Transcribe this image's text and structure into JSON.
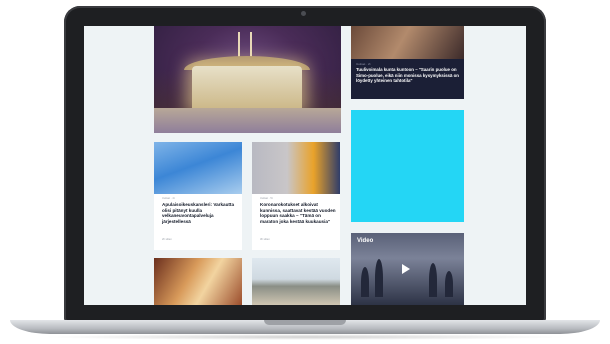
{
  "dark_article": {
    "meta": "Uutiset · 2t",
    "title": "Tuulivoimala kunta kuntoon – \"Saarin puolue on Simo-puolue, eikä niin monissa kysymyksissä on löydetty yhteinen tahtotila\""
  },
  "articles": [
    {
      "meta": "Uutiset · 4t",
      "title": "Apulaisoikeuskansleri: Varkautta olisi pitänyt kuulla velkaneuvontapalveluja järjestellessä",
      "date": "2h sitten"
    },
    {
      "meta": "Uutiset · 5t",
      "title": "Koronarokotukset alkoivat kunnissa, saattavat kestää vuoden loppuun saakka – \"Tämä on maraton joka kestää kuukausia\"",
      "date": "3h sitten"
    }
  ],
  "video": {
    "label": "Video"
  },
  "colors": {
    "ad_background": "#24d6f5",
    "dark_card": "#1b1f36",
    "screen_bg": "#eef3f5"
  }
}
